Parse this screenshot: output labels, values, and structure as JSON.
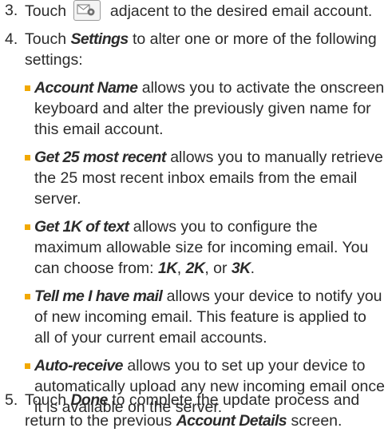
{
  "step3": {
    "num": "3.",
    "text_before": "Touch",
    "icon": "email-settings-icon",
    "text_after": "adjacent to the desired email account."
  },
  "step4": {
    "num": "4.",
    "touch": "Touch ",
    "settings": "Settings",
    "intro_rest": " to alter one or more of the following settings:",
    "bullets": [
      {
        "term": "Account Name",
        "text": " allows you to activate the onscreen keyboard and alter the previously given name for this email account."
      },
      {
        "term": "Get 25 most recent",
        "text": " allows you to manually retrieve the 25 most recent inbox emails from the email server."
      },
      {
        "term": "Get 1K of text",
        "text": " allows you to configure the maximum allowable size for incoming email. You can choose from: ",
        "opt1": "1K",
        "sep1": ", ",
        "opt2": "2K",
        "sep2": ", or ",
        "opt3": "3K",
        "end": "."
      },
      {
        "term": "Tell me I have mail",
        "text": " allows your device to notify you of new incoming email. This feature is applied to all of your current email accounts."
      },
      {
        "term": "Auto-receive",
        "text": " allows you to set up your device to automatically upload any new incoming email once it is available on the server."
      }
    ]
  },
  "step5": {
    "num": "5.",
    "touch": "Touch ",
    "done": "Done",
    "mid": " to complete the update process and return to the previous ",
    "account_details": "Account Details",
    "end": " screen."
  },
  "colors": {
    "bullet": "#f2a900",
    "text": "#2b2b2b"
  }
}
